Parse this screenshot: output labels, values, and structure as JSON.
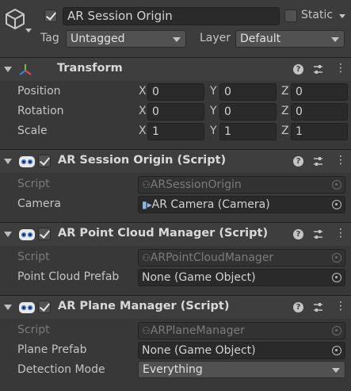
{
  "header": {
    "object_name": "AR Session Origin",
    "static_label": "Static",
    "tag_label": "Tag",
    "tag_value": "Untagged",
    "layer_label": "Layer",
    "layer_value": "Default",
    "active": true,
    "static": false
  },
  "transform": {
    "title": "Transform",
    "rows": [
      {
        "label": "Position",
        "x": "0",
        "y": "0",
        "z": "0"
      },
      {
        "label": "Rotation",
        "x": "0",
        "y": "0",
        "z": "0"
      },
      {
        "label": "Scale",
        "x": "1",
        "y": "1",
        "z": "1"
      }
    ],
    "axes": [
      "X",
      "Y",
      "Z"
    ]
  },
  "components": [
    {
      "title": "AR Session Origin (Script)",
      "enabled": true,
      "script_label": "Script",
      "script_value": "ARSessionOrigin",
      "field_label": "Camera",
      "field_value": "AR Camera (Camera)"
    },
    {
      "title": "AR Point Cloud Manager (Script)",
      "enabled": true,
      "script_label": "Script",
      "script_value": "ARPointCloudManager",
      "field_label": "Point Cloud Prefab",
      "field_value": "None (Game Object)"
    },
    {
      "title": "AR Plane Manager (Script)",
      "enabled": true,
      "script_label": "Script",
      "script_value": "ARPlaneManager",
      "field_label": "Plane Prefab",
      "field_value": "None (Game Object)",
      "extra_label": "Detection Mode",
      "extra_value": "Everything"
    }
  ],
  "icons": {
    "gameobject": "cube-icon",
    "transform": "transform-axes-icon",
    "script": "script-icon",
    "help": "help-icon",
    "presets": "presets-icon",
    "menu": "kebab-menu-icon",
    "camera": "camera-icon"
  },
  "colors": {
    "background": "#383838",
    "header": "#3e3e3e",
    "field": "#2a2a2a",
    "dropdown": "#515151"
  }
}
